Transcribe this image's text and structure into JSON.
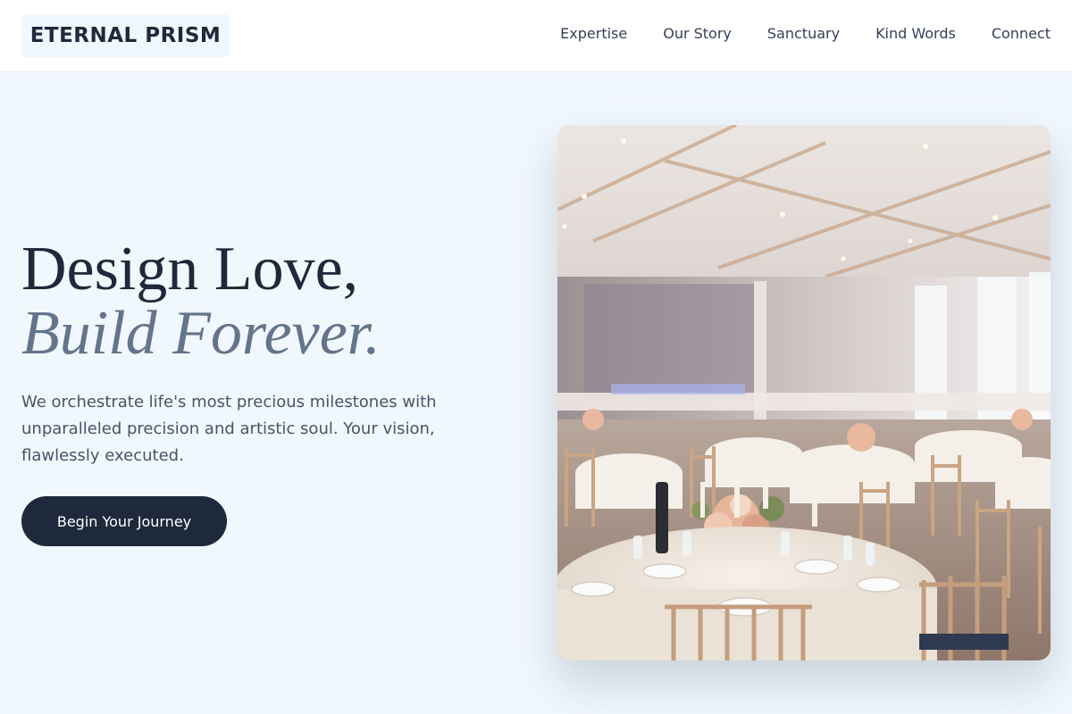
{
  "header": {
    "logo": "ETERNAL PRISM",
    "nav": [
      "Expertise",
      "Our Story",
      "Sanctuary",
      "Kind Words",
      "Connect"
    ]
  },
  "hero": {
    "title_line1": "Design Love,",
    "title_line2": "Build Forever.",
    "description": "We orchestrate life's most precious milestones with unparalleled precision and artistic soul. Your vision, flawlessly executed.",
    "cta_label": "Begin Your Journey"
  },
  "colors": {
    "background": "#f0f7fd",
    "primary": "#1e293b",
    "muted": "#64748b"
  },
  "image": {
    "subject": "wedding-banquet-hall-photo"
  }
}
